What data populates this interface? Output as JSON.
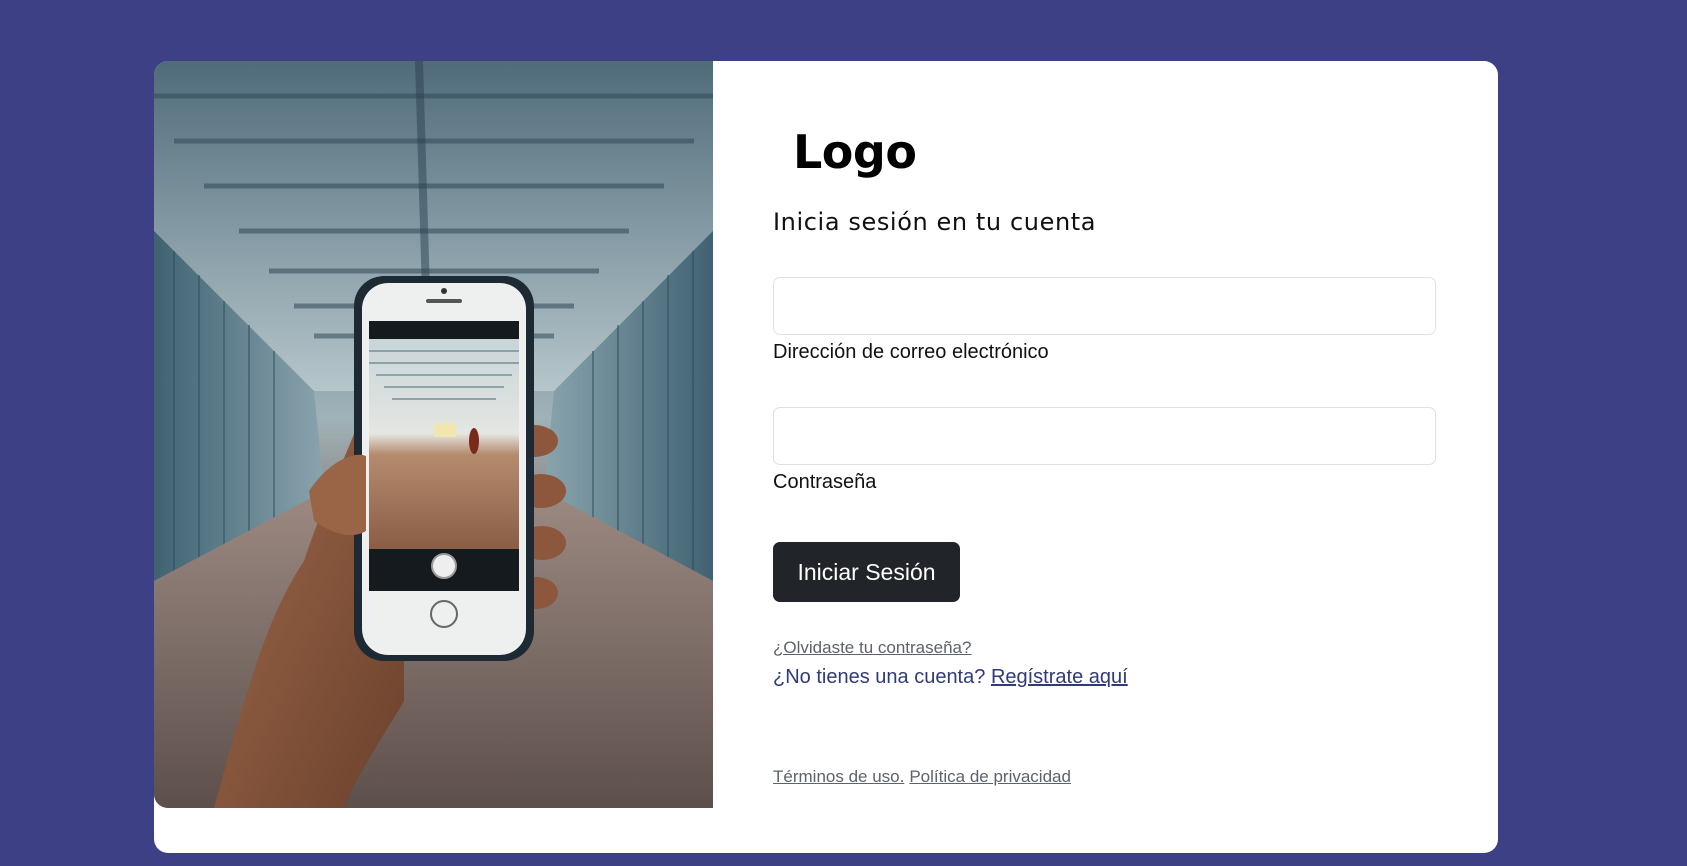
{
  "brand": {
    "logo_text": "Logo"
  },
  "login": {
    "subtitle": "Inicia sesión en tu cuenta",
    "email_label": "Dirección de correo electrónico",
    "email_value": "",
    "password_label": "Contraseña",
    "password_value": "",
    "submit_label": "Iniciar Sesión",
    "forgot_link": "¿Olvidaste tu contraseña?",
    "no_account_text": "¿No tienes una cuenta?",
    "register_link": "Regístrate aquí"
  },
  "footer": {
    "terms_link": "Términos de uso.",
    "privacy_link": "Política de privacidad"
  },
  "colors": {
    "page_background": "#3d4084",
    "button": "#212529",
    "register_text": "#303a7a"
  },
  "hero": {
    "image_subject": "hand-holding-phone-photo"
  }
}
